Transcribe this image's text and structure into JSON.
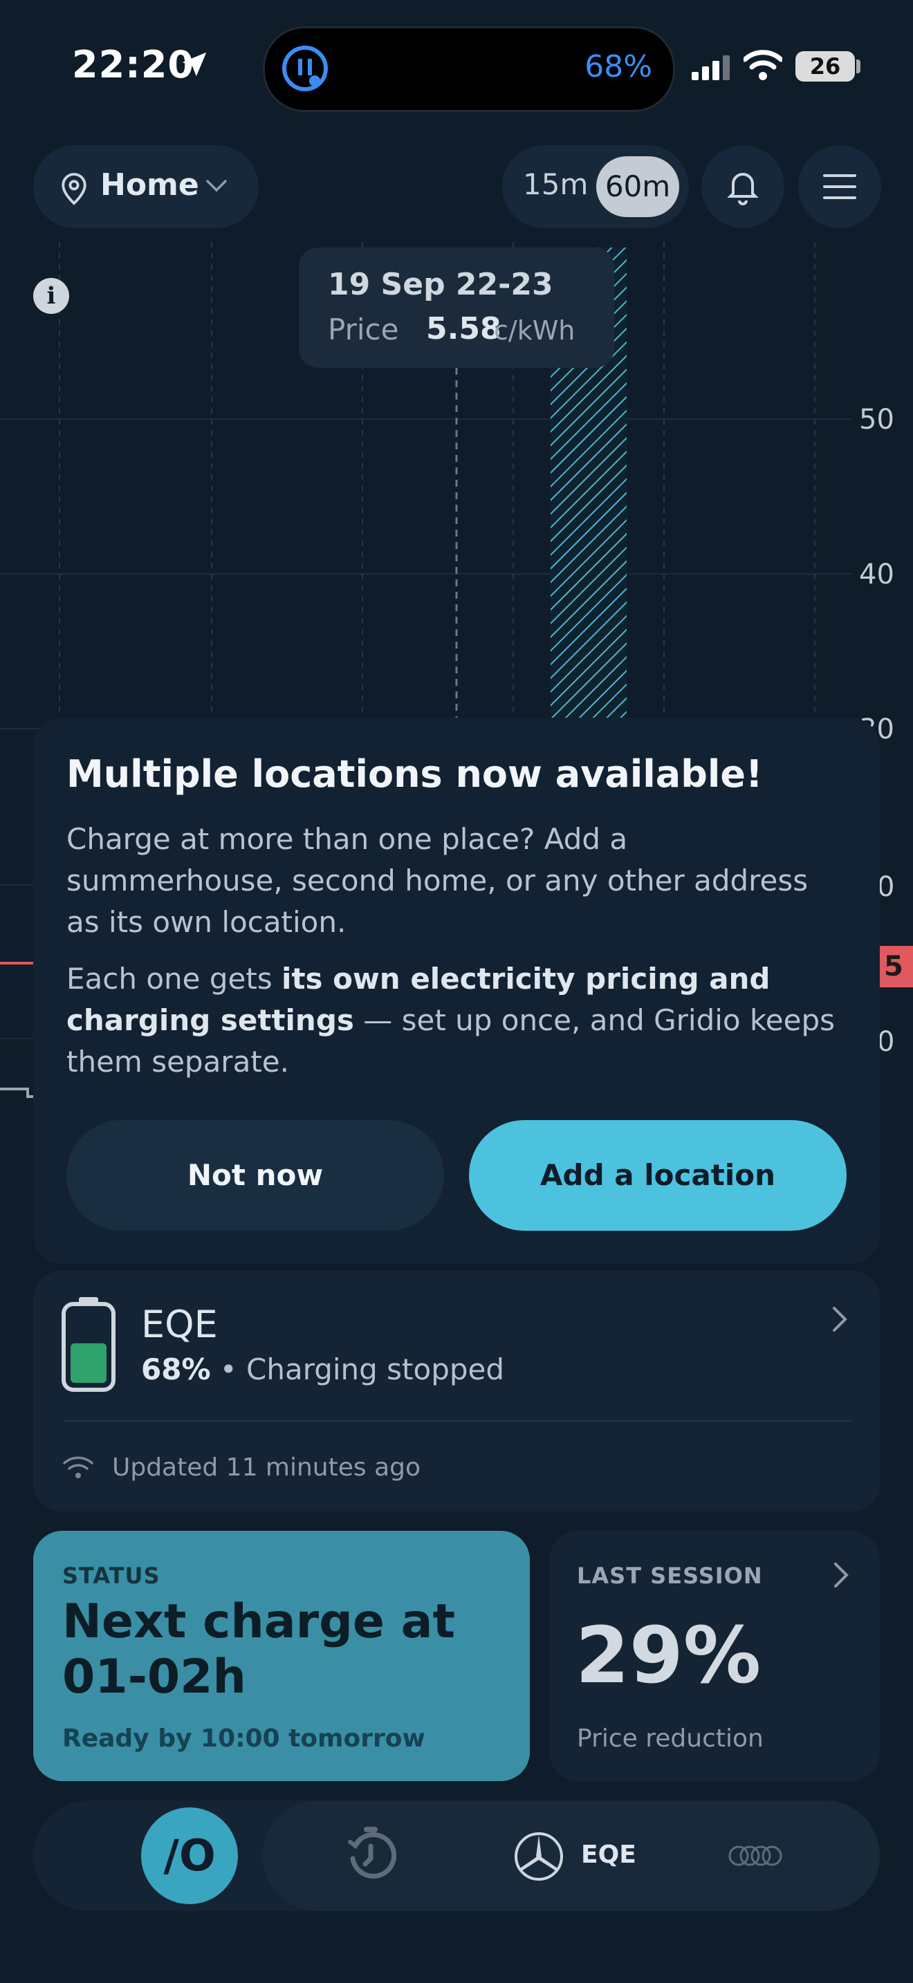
{
  "status_bar": {
    "time": "22:20",
    "island_battery": "68%",
    "battery": "26"
  },
  "header": {
    "location": "Home",
    "intervals": [
      "15m",
      "60m"
    ],
    "selected_interval": "60m"
  },
  "chart": {
    "tooltip_date": "19 Sep 22-23",
    "tooltip_price_label": "Price",
    "tooltip_price_value": "5.58",
    "tooltip_price_unit": "c/kWh",
    "y_labels": [
      "50",
      "40",
      "30",
      "0",
      "0"
    ],
    "current_price_badge": "5"
  },
  "modal": {
    "title": "Multiple locations now available!",
    "p1": "Charge at more than one place? Add a summerhouse, second home, or any other address as its own location.",
    "p2_pre": "Each one gets ",
    "p2_bold": "its own electricity pricing and charging settings",
    "p2_post": " — set up once, and Gridio keeps them separate.",
    "btn_not_now": "Not now",
    "btn_add": "Add a location"
  },
  "vehicle": {
    "name": "EQE",
    "charge": "68%",
    "status": " • Charging stopped",
    "updated": "Updated 11 minutes ago",
    "battery_level": 0.55,
    "battery_color": "#2fa36b"
  },
  "status_tile": {
    "label": "STATUS",
    "main": "Next charge at 01-02h",
    "sub": "Ready by 10:00 tomorrow"
  },
  "last_session": {
    "label": "LAST SESSION",
    "value": "29%",
    "sub": "Price reduction"
  },
  "nav": {
    "logo": "/O",
    "vehicle_label": "EQE"
  },
  "colors": {
    "accent": "#4cc2de",
    "background": "#0f1c29",
    "card": "#142434"
  }
}
